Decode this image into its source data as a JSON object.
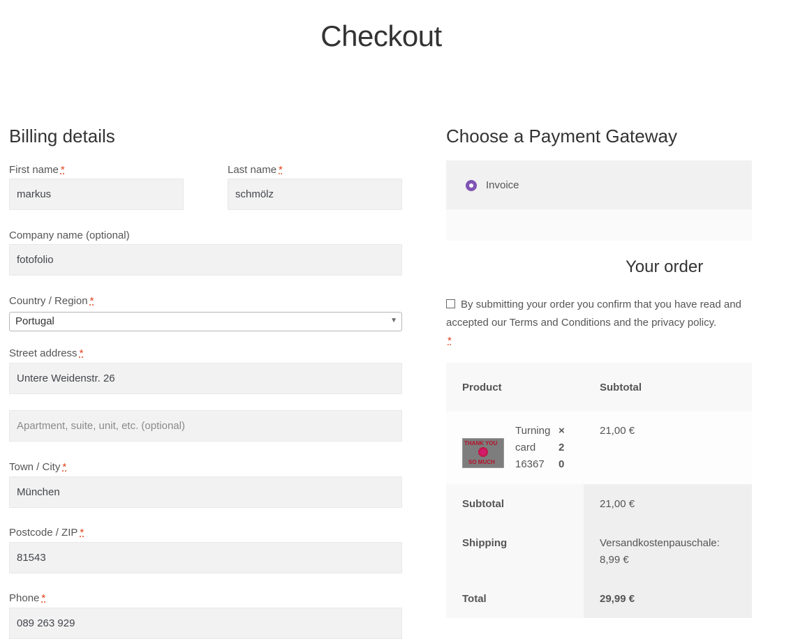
{
  "page": {
    "title": "Checkout"
  },
  "billing": {
    "heading": "Billing details",
    "required_mark": "*",
    "first_name": {
      "label": "First name",
      "value": "markus"
    },
    "last_name": {
      "label": "Last name",
      "value": "schmölz"
    },
    "company": {
      "label": "Company name (optional)",
      "value": "fotofolio"
    },
    "country": {
      "label": "Country / Region",
      "value": "Portugal"
    },
    "street": {
      "label": "Street address",
      "value": "Untere Weidenstr. 26"
    },
    "apartment": {
      "placeholder": "Apartment, suite, unit, etc. (optional)"
    },
    "city": {
      "label": "Town / City",
      "value": "München"
    },
    "postcode": {
      "label": "Postcode / ZIP",
      "value": "81543"
    },
    "phone": {
      "label": "Phone",
      "value": "089 263 929"
    }
  },
  "payment": {
    "heading": "Choose a Payment Gateway",
    "option_label": "Invoice"
  },
  "order": {
    "heading": "Your order",
    "terms_text": "By submitting your order you confirm that you have read and accepted our Terms and Conditions and the privacy policy.",
    "required_mark": "*",
    "col_product": "Product",
    "col_subtotal": "Subtotal",
    "item": {
      "name_lines": [
        "Turning",
        "card",
        "16367"
      ],
      "qty_lines": [
        "×",
        "2",
        "0"
      ],
      "subtotal": "21,00 €",
      "image_text_top": "THANK YOU",
      "image_text_bottom": "SO MUCH"
    },
    "subtotal_label": "Subtotal",
    "subtotal_value": "21,00 €",
    "shipping_label": "Shipping",
    "shipping_value_line1": "Versandkostenpauschale:",
    "shipping_value_line2": "8,99 €",
    "total_label": "Total",
    "total_value": "29,99 €"
  },
  "colors": {
    "accent": "#7f54b3",
    "required": "#e2401c"
  }
}
